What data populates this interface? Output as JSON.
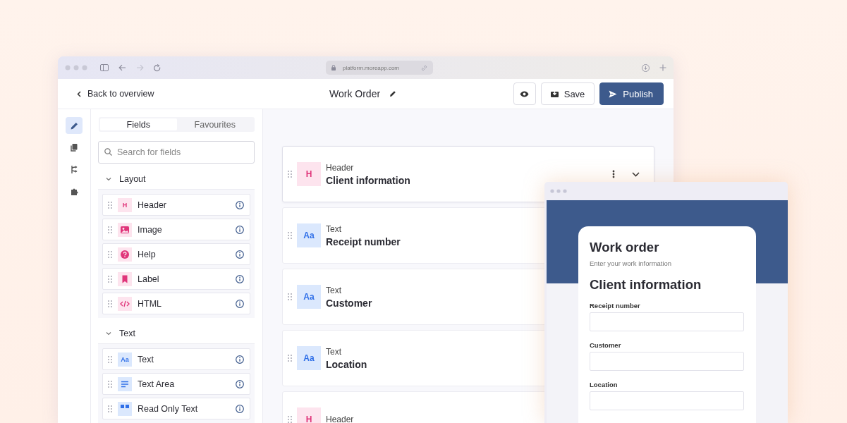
{
  "browser": {
    "url": "platform.moreapp.com"
  },
  "app_header": {
    "back_link": "Back to overview",
    "title": "Work Order",
    "save": "Save",
    "publish": "Publish"
  },
  "rail": [
    {
      "kind": "edit",
      "selected": true
    },
    {
      "kind": "copy",
      "selected": false
    },
    {
      "kind": "flow",
      "selected": false
    },
    {
      "kind": "plugin",
      "selected": false
    }
  ],
  "tabs": [
    {
      "label": "Fields",
      "selected": true
    },
    {
      "label": "Favourites",
      "selected": false
    }
  ],
  "search": {
    "placeholder": "Search for fields"
  },
  "groups": [
    {
      "title": "Layout",
      "expanded": true,
      "items": [
        {
          "label": "Header",
          "kind": "header",
          "badge": "H"
        },
        {
          "label": "Image",
          "kind": "image"
        },
        {
          "label": "Help",
          "kind": "help"
        },
        {
          "label": "Label",
          "kind": "label"
        },
        {
          "label": "HTML",
          "kind": "html"
        }
      ]
    },
    {
      "title": "Text",
      "expanded": true,
      "items": [
        {
          "label": "Text",
          "kind": "text",
          "badge": "Aa"
        },
        {
          "label": "Text Area",
          "kind": "textarea"
        },
        {
          "label": "Read Only Text",
          "kind": "readonly"
        }
      ]
    }
  ],
  "form_fields": [
    {
      "type": "Header",
      "title": "Client information",
      "kind": "header",
      "badge": "H",
      "hovered": true
    },
    {
      "type": "Text",
      "title": "Receipt number",
      "kind": "text",
      "badge": "Aa",
      "hovered": false
    },
    {
      "type": "Text",
      "title": "Customer",
      "kind": "text",
      "badge": "Aa",
      "hovered": false
    },
    {
      "type": "Text",
      "title": "Location",
      "kind": "text",
      "badge": "Aa",
      "hovered": false
    },
    {
      "type": "Header",
      "kind": "header",
      "badge": "H",
      "hovered": false
    }
  ],
  "preview": {
    "title": "Work order",
    "subtitle": "Enter your work information",
    "section": "Client information",
    "fields": [
      "Receipt number",
      "Customer",
      "Location"
    ]
  }
}
